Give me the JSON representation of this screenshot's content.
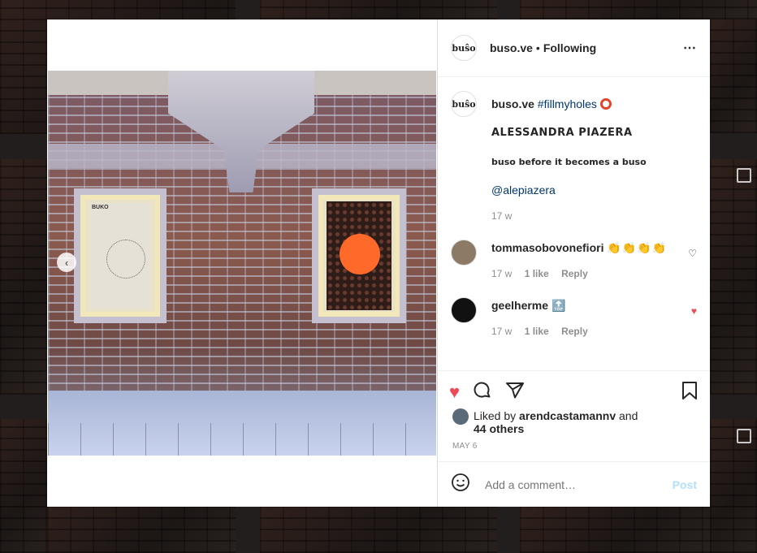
{
  "colors": {
    "accent": "#0095f6",
    "like": "#ed4956",
    "muted": "#8e8e8e",
    "text": "#262626"
  },
  "header": {
    "avatar_text": "buŝo",
    "username": "buso.ve",
    "separator": "•",
    "follow_label": "Following",
    "more_icon": "⋯"
  },
  "caption": {
    "avatar_text": "buŝo",
    "username": "buso.ve",
    "hashtag": "#fillmyholes",
    "line1": "ALESSANDRA PIAZERA",
    "line2": "buso before it becomes a buso",
    "mention": "@alepiazera",
    "time": "17 w"
  },
  "comments": [
    {
      "username": "tommasobovonefiori",
      "text": "👏👏👏👏",
      "time": "17 w",
      "likes": "1 like",
      "reply": "Reply",
      "liked": false
    },
    {
      "username": "geelherme",
      "text": "🔝",
      "time": "17 w",
      "likes": "1 like",
      "reply": "Reply",
      "liked": true
    }
  ],
  "footer": {
    "liked_by_prefix": "Liked by",
    "liked_by_user": "arendcastamannv",
    "and": "and",
    "others": "44 others",
    "date": "MAY 6"
  },
  "add_comment": {
    "placeholder": "Add a comment…",
    "post_label": "Post"
  },
  "photo": {
    "poster_tag": "BUKO"
  },
  "icons": {
    "like": "heart-icon",
    "comment": "comment-icon",
    "share": "share-icon",
    "save": "bookmark-icon",
    "emoji": "smile-icon",
    "prev": "chevron-left-icon"
  }
}
